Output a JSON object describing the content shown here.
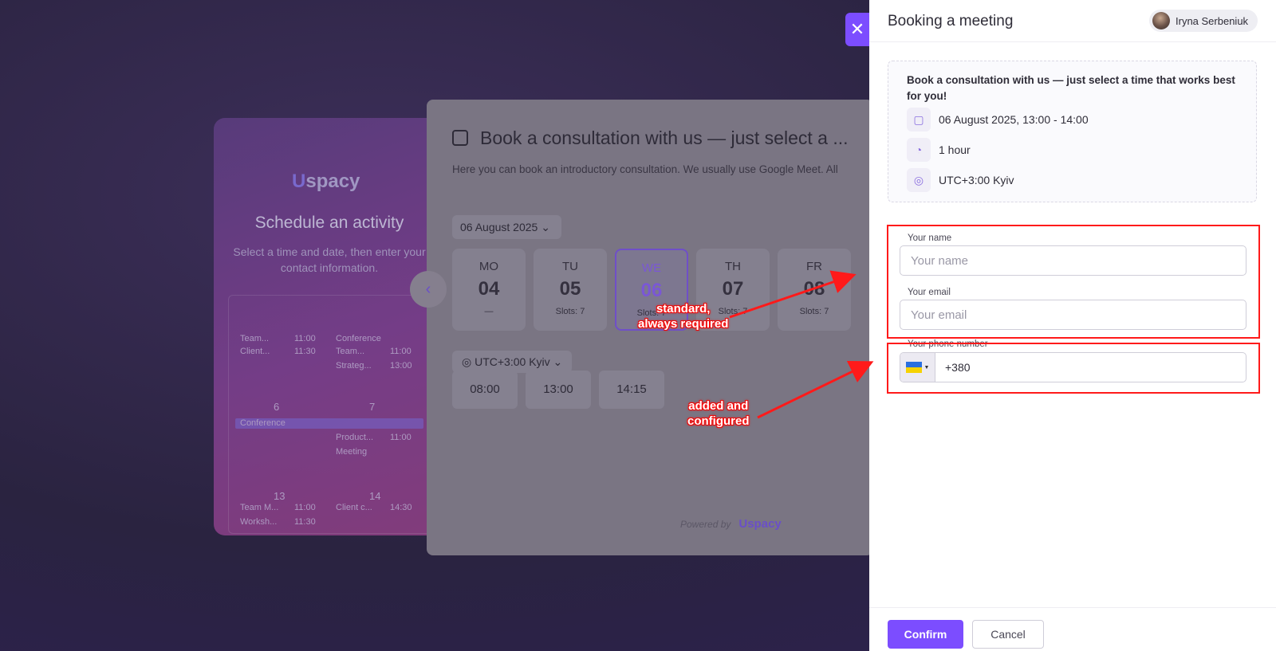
{
  "background": {
    "logo_text": "spacy",
    "schedule_title": "Schedule an activity",
    "schedule_subtitle": "Select a time and date, then enter your contact information.",
    "calendar_items": [
      "Team...",
      "11:00",
      "Client...",
      "11:30",
      "Conference",
      "Team...",
      "11:00",
      "Strateg...",
      "13:00",
      "6",
      "7",
      "Conference",
      "Product...",
      "11:00",
      "Meeting",
      "13",
      "14",
      "Team M...",
      "11:00",
      "Client c...",
      "14:30",
      "Worksh...",
      "11:30"
    ],
    "booking_title": "Book a consultation with us — just select a ...",
    "booking_desc": "Here you can book an introductory consultation. We usually use Google Meet. All",
    "date_select": "06 August 2025",
    "days": [
      {
        "name": "MO",
        "num": "04",
        "slots": "—"
      },
      {
        "name": "TU",
        "num": "05",
        "slots": "Slots: 7"
      },
      {
        "name": "WE",
        "num": "06",
        "slots": "Slots: 7"
      },
      {
        "name": "TH",
        "num": "07",
        "slots": "Slots: 7"
      },
      {
        "name": "FR",
        "num": "08",
        "slots": "Slots: 7"
      }
    ],
    "timezone": "UTC+3:00 Kyiv",
    "slots": [
      "08:00",
      "13:00",
      "14:15"
    ],
    "powered_by": "Powered by",
    "powered_logo": "spacy"
  },
  "drawer": {
    "close_label": "✕",
    "title": "Booking a meeting",
    "user_name": "Iryna Serbeniuk",
    "info": {
      "headline": "Book a consultation with us — just select a time that works best for you!",
      "datetime": "06 August 2025, 13:00 - 14:00",
      "duration": "1 hour",
      "timezone": "UTC+3:00 Kyiv"
    },
    "form": {
      "name_label": "Your name",
      "name_placeholder": "Your name",
      "email_label": "Your email",
      "email_placeholder": "Your email",
      "phone_label": "Your phone number",
      "phone_value": "+380"
    },
    "confirm_label": "Confirm",
    "cancel_label": "Cancel"
  },
  "annotations": {
    "note_standard": "standard,\nalways required",
    "note_added": "added and\nconfigured",
    "color": "#ff1a1a"
  },
  "colors": {
    "accent": "#7c4dff",
    "annotation": "#ff1a1a"
  }
}
